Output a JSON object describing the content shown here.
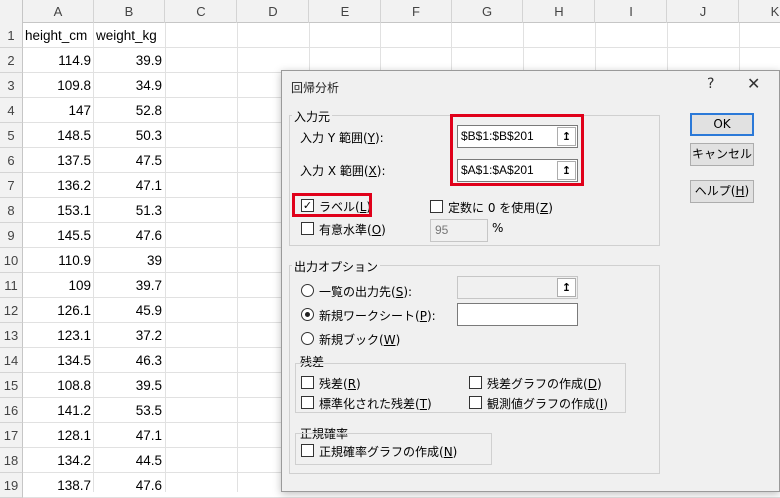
{
  "columns": [
    "A",
    "B",
    "C",
    "D",
    "E",
    "F",
    "G",
    "H",
    "I",
    "J",
    "K"
  ],
  "rows": [
    {
      "n": "1",
      "a": "height_cm",
      "b": "weight_kg"
    },
    {
      "n": "2",
      "a": "114.9",
      "b": "39.9"
    },
    {
      "n": "3",
      "a": "109.8",
      "b": "34.9"
    },
    {
      "n": "4",
      "a": "147",
      "b": "52.8"
    },
    {
      "n": "5",
      "a": "148.5",
      "b": "50.3"
    },
    {
      "n": "6",
      "a": "137.5",
      "b": "47.5"
    },
    {
      "n": "7",
      "a": "136.2",
      "b": "47.1"
    },
    {
      "n": "8",
      "a": "153.1",
      "b": "51.3"
    },
    {
      "n": "9",
      "a": "145.5",
      "b": "47.6"
    },
    {
      "n": "10",
      "a": "110.9",
      "b": "39"
    },
    {
      "n": "11",
      "a": "109",
      "b": "39.7"
    },
    {
      "n": "12",
      "a": "126.1",
      "b": "45.9"
    },
    {
      "n": "13",
      "a": "123.1",
      "b": "37.2"
    },
    {
      "n": "14",
      "a": "134.5",
      "b": "46.3"
    },
    {
      "n": "15",
      "a": "108.8",
      "b": "39.5"
    },
    {
      "n": "16",
      "a": "141.2",
      "b": "53.5"
    },
    {
      "n": "17",
      "a": "128.1",
      "b": "47.1"
    },
    {
      "n": "18",
      "a": "134.2",
      "b": "44.5"
    },
    {
      "n": "19",
      "a": "138.7",
      "b": "47.6"
    }
  ],
  "dialog": {
    "title": "回帰分析",
    "help_glyph": "?",
    "close_glyph": "✕",
    "input_group": "入力元",
    "y_range_label": "入力 Y 範囲(",
    "y_range_key": "Y",
    "y_range_suffix": "):",
    "y_range_value": "$B$1:$B$201",
    "x_range_label": "入力 X 範囲(",
    "x_range_key": "X",
    "x_range_suffix": "):",
    "x_range_value": "$A$1:$A$201",
    "ref_icon": "↥",
    "label_prefix": "ラベル(",
    "label_key": "L",
    "label_suffix": ")",
    "const_zero_prefix": "定数に 0 を使用(",
    "const_zero_key": "Z",
    "const_zero_suffix": ")",
    "confidence_prefix": "有意水準(",
    "confidence_key": "O",
    "confidence_suffix": ")",
    "confidence_value": "95",
    "percent": "%",
    "output_group": "出力オプション",
    "out_range_prefix": "一覧の出力先(",
    "out_range_key": "S",
    "out_range_suffix": "):",
    "new_sheet_prefix": "新規ワークシート(",
    "new_sheet_key": "P",
    "new_sheet_suffix": "):",
    "new_book_prefix": "新規ブック(",
    "new_book_key": "W",
    "new_book_suffix": ")",
    "residuals_group": "残差",
    "residuals_prefix": "残差(",
    "residuals_key": "R",
    "residuals_suffix": ")",
    "std_residuals_prefix": "標準化された残差(",
    "std_residuals_key": "T",
    "std_residuals_suffix": ")",
    "residual_plots_prefix": "残差グラフの作成(",
    "residual_plots_key": "D",
    "residual_plots_suffix": ")",
    "line_fit_prefix": "観測値グラフの作成(",
    "line_fit_key": "I",
    "line_fit_suffix": ")",
    "normal_group": "正規確率",
    "normal_plot_prefix": "正規確率グラフの作成(",
    "normal_plot_key": "N",
    "normal_plot_suffix": ")",
    "ok": "OK",
    "cancel": "キャンセル",
    "help_prefix": "ヘルプ(",
    "help_key": "H",
    "help_suffix": ")",
    "checkmark": "✓"
  },
  "colors": {
    "highlight": "#e0001a",
    "accent": "#2b79d8"
  }
}
